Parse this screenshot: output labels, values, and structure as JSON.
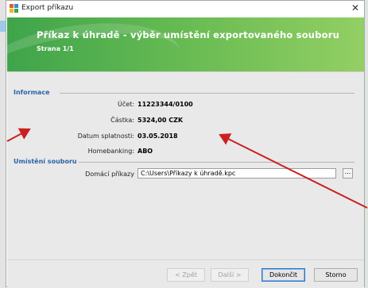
{
  "window": {
    "title": "Export příkazu",
    "close_glyph": "✕"
  },
  "banner": {
    "heading": "Příkaz k úhradě - výběr umístění exportovaného souboru",
    "subheading": "Strana 1/1"
  },
  "info_group": {
    "title": "Informace",
    "fields": [
      {
        "label": "Účet:",
        "value": "11223344/0100"
      },
      {
        "label": "Částka:",
        "value": "5324,00 CZK"
      },
      {
        "label": "Datum splatnosti:",
        "value": "03.05.2018"
      },
      {
        "label": "Homebanking:",
        "value": "ABO"
      }
    ]
  },
  "location_group": {
    "title": "Umístění souboru",
    "label": "Domácí příkazy",
    "path_value": "C:\\Users\\Příkazy k úhradě.kpc",
    "browse_label": "..."
  },
  "footer": {
    "back": "< Zpět",
    "next": "Další >",
    "finish": "Dokončit",
    "cancel": "Storno"
  },
  "colors": {
    "banner_start": "#3fa44a",
    "banner_end": "#93cf64",
    "group_title": "#2b64a8",
    "annotation_arrow": "#cc2020"
  },
  "icons": [
    "app-export-icon",
    "close-icon",
    "browse-ellipsis-icon",
    "annotation-arrow"
  ]
}
